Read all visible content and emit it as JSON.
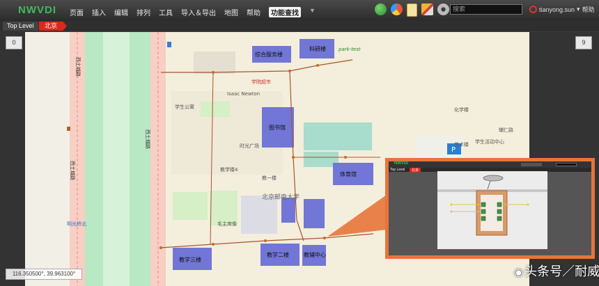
{
  "app": {
    "logo": "NWVDI"
  },
  "menu": {
    "items": [
      "页面",
      "插入",
      "编辑",
      "排列",
      "工具",
      "导入＆导出",
      "地图",
      "帮助"
    ],
    "active": "功能查找",
    "more": "▼"
  },
  "search": {
    "placeholder": "搜索"
  },
  "user": {
    "name": "tianyong.sun",
    "help": "帮助"
  },
  "breadcrumb": {
    "root": "Top Level",
    "current": "北京"
  },
  "badges": {
    "left": "0",
    "right": "9"
  },
  "coords": "116.350500°, 39.963100°",
  "map": {
    "labels": {
      "b1": "综合服务楼",
      "b2": "科研楼",
      "b3": "图书馆",
      "b4": "体育馆",
      "b5": "教学三楼",
      "b6": "教学二楼",
      "b7": "教辅中心",
      "campus": "北京邮电大学",
      "park": "park-test",
      "store": "学院超市",
      "newton": "Isaac Newton",
      "sq": "时光广场",
      "mz": "毛主席像",
      "road1": "西土城路",
      "road2": "西土城路",
      "road3": "西土城路",
      "chem": "化学楼",
      "art": "艺术楼",
      "stu": "学生活动中心",
      "fudao": "辅仁路",
      "yg": "明光桥北",
      "t4": "教学楼4",
      "jyi": "教一楼",
      "ss": "学生公寓",
      "tiyu": "体育馆"
    }
  },
  "inset": {
    "title": "NWVDI",
    "crumb_root": "Top Level",
    "crumb_current": "北京"
  },
  "watermark": "头条号／耐威迪"
}
